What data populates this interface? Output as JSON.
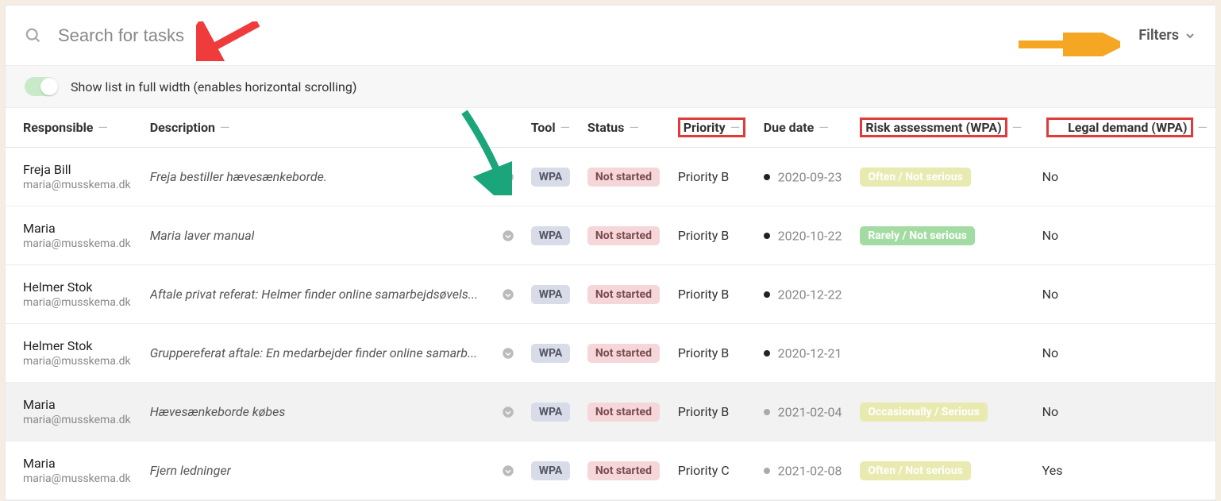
{
  "search": {
    "placeholder": "Search for tasks"
  },
  "filters_label": "Filters",
  "fullwidth_label": "Show list in full width (enables horizontal scrolling)",
  "columns": {
    "responsible": "Responsible",
    "description": "Description",
    "tool": "Tool",
    "status": "Status",
    "priority": "Priority",
    "due_date": "Due date",
    "risk": "Risk assessment (WPA)",
    "legal": "Legal demand (WPA)"
  },
  "rows": [
    {
      "name": "Freja Bill",
      "email": "maria@musskema.dk",
      "description": "Freja bestiller hævesænkeborde.",
      "tool": "WPA",
      "status": "Not started",
      "priority": "Priority B",
      "due_date": "2020-09-23",
      "due_color": "#222",
      "risk": "Often / Not serious",
      "risk_class": "badge-risk-often",
      "legal": "No",
      "highlight": false
    },
    {
      "name": "Maria",
      "email": "maria@musskema.dk",
      "description": "Maria laver manual",
      "tool": "WPA",
      "status": "Not started",
      "priority": "Priority B",
      "due_date": "2020-10-22",
      "due_color": "#222",
      "risk": "Rarely / Not serious",
      "risk_class": "badge-risk-rarely",
      "legal": "No",
      "highlight": false
    },
    {
      "name": "Helmer Stok",
      "email": "maria@musskema.dk",
      "description": "Aftale privat referat: Helmer finder online samarbejdsøvels...",
      "tool": "WPA",
      "status": "Not started",
      "priority": "Priority B",
      "due_date": "2020-12-22",
      "due_color": "#222",
      "risk": "",
      "risk_class": "",
      "legal": "No",
      "highlight": false
    },
    {
      "name": "Helmer Stok",
      "email": "maria@musskema.dk",
      "description": "Gruppereferat aftale: En medarbejder finder online samarb...",
      "tool": "WPA",
      "status": "Not started",
      "priority": "Priority B",
      "due_date": "2020-12-21",
      "due_color": "#222",
      "risk": "",
      "risk_class": "",
      "legal": "No",
      "highlight": false
    },
    {
      "name": "Maria",
      "email": "maria@musskema.dk",
      "description": "Hævesænkeborde købes",
      "tool": "WPA",
      "status": "Not started",
      "priority": "Priority B",
      "due_date": "2021-02-04",
      "due_color": "#aaa",
      "risk": "Occasionally / Serious",
      "risk_class": "badge-risk-occ",
      "legal": "No",
      "highlight": true
    },
    {
      "name": "Maria",
      "email": "maria@musskema.dk",
      "description": "Fjern ledninger",
      "tool": "WPA",
      "status": "Not started",
      "priority": "Priority C",
      "due_date": "2021-02-08",
      "due_color": "#aaa",
      "risk": "Often / Not serious",
      "risk_class": "badge-risk-often",
      "legal": "Yes",
      "highlight": false
    }
  ]
}
